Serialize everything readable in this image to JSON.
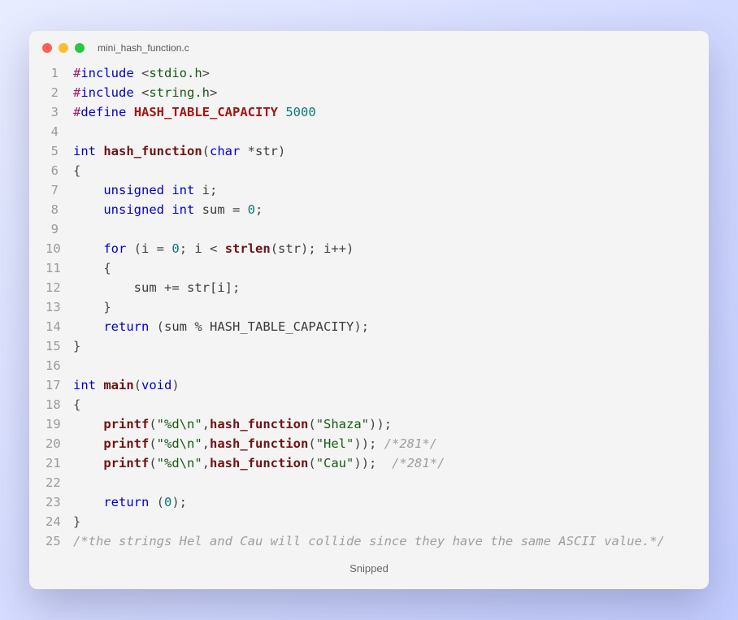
{
  "window": {
    "filename": "mini_hash_function.c",
    "traffic_lights": [
      "close",
      "minimize",
      "zoom"
    ]
  },
  "footer": {
    "label": "Snipped"
  },
  "code": {
    "lines": {
      "1": {
        "parts": [
          {
            "cls": "pp",
            "t": "#"
          },
          {
            "cls": "kw",
            "t": "include"
          },
          {
            "cls": "punct",
            "t": " <"
          },
          {
            "cls": "str",
            "t": "stdio.h"
          },
          {
            "cls": "punct",
            "t": ">"
          }
        ]
      },
      "2": {
        "parts": [
          {
            "cls": "pp",
            "t": "#"
          },
          {
            "cls": "kw",
            "t": "include"
          },
          {
            "cls": "punct",
            "t": " <"
          },
          {
            "cls": "str",
            "t": "string.h"
          },
          {
            "cls": "punct",
            "t": ">"
          }
        ]
      },
      "3": {
        "parts": [
          {
            "cls": "pp",
            "t": "#"
          },
          {
            "cls": "kw",
            "t": "define"
          },
          {
            "cls": "punct",
            "t": " "
          },
          {
            "cls": "macro",
            "t": "HASH_TABLE_CAPACITY"
          },
          {
            "cls": "punct",
            "t": " "
          },
          {
            "cls": "num",
            "t": "5000"
          }
        ]
      },
      "4": {
        "parts": [
          {
            "cls": "punct",
            "t": ""
          }
        ]
      },
      "5": {
        "parts": [
          {
            "cls": "kw",
            "t": "int"
          },
          {
            "cls": "punct",
            "t": " "
          },
          {
            "cls": "fn",
            "t": "hash_function"
          },
          {
            "cls": "punct",
            "t": "("
          },
          {
            "cls": "kw",
            "t": "char"
          },
          {
            "cls": "punct",
            "t": " *"
          },
          {
            "cls": "id",
            "t": "str"
          },
          {
            "cls": "punct",
            "t": ")"
          }
        ]
      },
      "6": {
        "parts": [
          {
            "cls": "punct",
            "t": "{"
          }
        ]
      },
      "7": {
        "parts": [
          {
            "cls": "punct",
            "t": "    "
          },
          {
            "cls": "kw",
            "t": "unsigned"
          },
          {
            "cls": "punct",
            "t": " "
          },
          {
            "cls": "kw",
            "t": "int"
          },
          {
            "cls": "punct",
            "t": " "
          },
          {
            "cls": "id",
            "t": "i"
          },
          {
            "cls": "punct",
            "t": ";"
          }
        ]
      },
      "8": {
        "parts": [
          {
            "cls": "punct",
            "t": "    "
          },
          {
            "cls": "kw",
            "t": "unsigned"
          },
          {
            "cls": "punct",
            "t": " "
          },
          {
            "cls": "kw",
            "t": "int"
          },
          {
            "cls": "punct",
            "t": " "
          },
          {
            "cls": "id",
            "t": "sum"
          },
          {
            "cls": "punct",
            "t": " = "
          },
          {
            "cls": "num",
            "t": "0"
          },
          {
            "cls": "punct",
            "t": ";"
          }
        ]
      },
      "9": {
        "parts": [
          {
            "cls": "punct",
            "t": ""
          }
        ]
      },
      "10": {
        "parts": [
          {
            "cls": "punct",
            "t": "    "
          },
          {
            "cls": "kw",
            "t": "for"
          },
          {
            "cls": "punct",
            "t": " ("
          },
          {
            "cls": "id",
            "t": "i"
          },
          {
            "cls": "punct",
            "t": " = "
          },
          {
            "cls": "num",
            "t": "0"
          },
          {
            "cls": "punct",
            "t": "; "
          },
          {
            "cls": "id",
            "t": "i"
          },
          {
            "cls": "punct",
            "t": " < "
          },
          {
            "cls": "fn",
            "t": "strlen"
          },
          {
            "cls": "punct",
            "t": "("
          },
          {
            "cls": "id",
            "t": "str"
          },
          {
            "cls": "punct",
            "t": "); "
          },
          {
            "cls": "id",
            "t": "i"
          },
          {
            "cls": "punct",
            "t": "++)"
          }
        ]
      },
      "11": {
        "parts": [
          {
            "cls": "punct",
            "t": "    {"
          }
        ]
      },
      "12": {
        "parts": [
          {
            "cls": "punct",
            "t": "        "
          },
          {
            "cls": "id",
            "t": "sum"
          },
          {
            "cls": "punct",
            "t": " += "
          },
          {
            "cls": "id",
            "t": "str"
          },
          {
            "cls": "punct",
            "t": "["
          },
          {
            "cls": "id",
            "t": "i"
          },
          {
            "cls": "punct",
            "t": "];"
          }
        ]
      },
      "13": {
        "parts": [
          {
            "cls": "punct",
            "t": "    }"
          }
        ]
      },
      "14": {
        "parts": [
          {
            "cls": "punct",
            "t": "    "
          },
          {
            "cls": "kw",
            "t": "return"
          },
          {
            "cls": "punct",
            "t": " ("
          },
          {
            "cls": "id",
            "t": "sum"
          },
          {
            "cls": "punct",
            "t": " % "
          },
          {
            "cls": "id",
            "t": "HASH_TABLE_CAPACITY"
          },
          {
            "cls": "punct",
            "t": ");"
          }
        ]
      },
      "15": {
        "parts": [
          {
            "cls": "punct",
            "t": "}"
          }
        ]
      },
      "16": {
        "parts": [
          {
            "cls": "punct",
            "t": ""
          }
        ]
      },
      "17": {
        "parts": [
          {
            "cls": "kw",
            "t": "int"
          },
          {
            "cls": "punct",
            "t": " "
          },
          {
            "cls": "fn",
            "t": "main"
          },
          {
            "cls": "punct",
            "t": "("
          },
          {
            "cls": "kw",
            "t": "void"
          },
          {
            "cls": "punct",
            "t": ")"
          }
        ]
      },
      "18": {
        "parts": [
          {
            "cls": "punct",
            "t": "{"
          }
        ]
      },
      "19": {
        "parts": [
          {
            "cls": "punct",
            "t": "    "
          },
          {
            "cls": "fn",
            "t": "printf"
          },
          {
            "cls": "punct",
            "t": "("
          },
          {
            "cls": "str",
            "t": "\"%d\\n\""
          },
          {
            "cls": "punct",
            "t": ","
          },
          {
            "cls": "fn",
            "t": "hash_function"
          },
          {
            "cls": "punct",
            "t": "("
          },
          {
            "cls": "str",
            "t": "\"Shaza\""
          },
          {
            "cls": "punct",
            "t": "));"
          }
        ]
      },
      "20": {
        "parts": [
          {
            "cls": "punct",
            "t": "    "
          },
          {
            "cls": "fn",
            "t": "printf"
          },
          {
            "cls": "punct",
            "t": "("
          },
          {
            "cls": "str",
            "t": "\"%d\\n\""
          },
          {
            "cls": "punct",
            "t": ","
          },
          {
            "cls": "fn",
            "t": "hash_function"
          },
          {
            "cls": "punct",
            "t": "("
          },
          {
            "cls": "str",
            "t": "\"Hel\""
          },
          {
            "cls": "punct",
            "t": ")); "
          },
          {
            "cls": "cmt",
            "t": "/*281*/"
          }
        ]
      },
      "21": {
        "parts": [
          {
            "cls": "punct",
            "t": "    "
          },
          {
            "cls": "fn",
            "t": "printf"
          },
          {
            "cls": "punct",
            "t": "("
          },
          {
            "cls": "str",
            "t": "\"%d\\n\""
          },
          {
            "cls": "punct",
            "t": ","
          },
          {
            "cls": "fn",
            "t": "hash_function"
          },
          {
            "cls": "punct",
            "t": "("
          },
          {
            "cls": "str",
            "t": "\"Cau\""
          },
          {
            "cls": "punct",
            "t": "));  "
          },
          {
            "cls": "cmt",
            "t": "/*281*/"
          }
        ]
      },
      "22": {
        "parts": [
          {
            "cls": "punct",
            "t": ""
          }
        ]
      },
      "23": {
        "parts": [
          {
            "cls": "punct",
            "t": "    "
          },
          {
            "cls": "kw",
            "t": "return"
          },
          {
            "cls": "punct",
            "t": " ("
          },
          {
            "cls": "num",
            "t": "0"
          },
          {
            "cls": "punct",
            "t": ");"
          }
        ]
      },
      "24": {
        "parts": [
          {
            "cls": "punct",
            "t": "}"
          }
        ]
      },
      "25": {
        "parts": [
          {
            "cls": "cmt",
            "t": "/*the strings Hel and Cau will collide since they have the same ASCII value.*/"
          }
        ]
      }
    },
    "line_count": 25
  }
}
